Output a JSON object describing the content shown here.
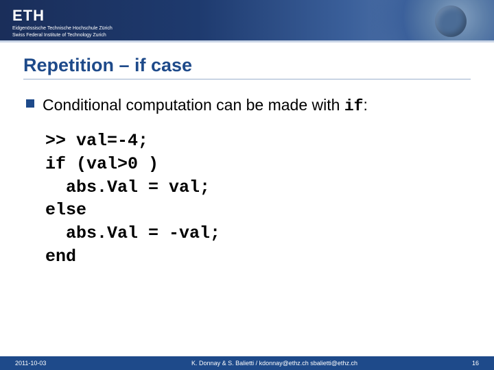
{
  "banner": {
    "logo_main": "ETH",
    "logo_sub1": "Eidgenössische Technische Hochschule Zürich",
    "logo_sub2": "Swiss Federal Institute of Technology Zurich"
  },
  "slide": {
    "title": "Repetition – if case",
    "bullet_pre": "Conditional computation can be made with ",
    "bullet_code": "if",
    "bullet_post": ":",
    "code": ">> val=-4;\nif (val>0 )\n  abs.Val = val;\nelse\n  abs.Val = -val;\nend"
  },
  "footer": {
    "date": "2011-10-03",
    "center": "K. Donnay & S. Balietti / kdonnay@ethz.ch sbalietti@ethz.ch",
    "page": "16"
  }
}
